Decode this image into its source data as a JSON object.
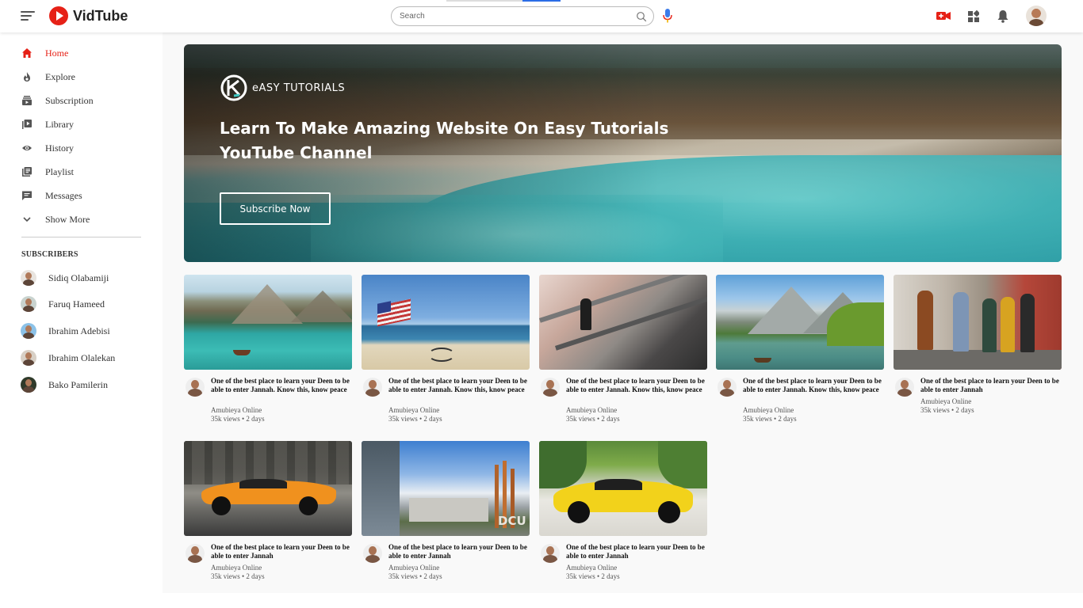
{
  "app": {
    "name": "VidTube"
  },
  "search": {
    "placeholder": "Search"
  },
  "icons": {
    "menu": "menu-icon",
    "logo": "play-logo-icon",
    "search": "search-icon",
    "mic": "mic-icon",
    "upload": "video-upload-icon",
    "apps": "apps-grid-icon",
    "notifications": "bell-icon"
  },
  "colors": {
    "accent": "#e62117",
    "mic_blue": "#3b7bea",
    "search_indicator": "#2b6de6"
  },
  "sidebar": {
    "nav": [
      {
        "label": "Home",
        "icon": "home-icon",
        "active": true
      },
      {
        "label": "Explore",
        "icon": "flame-icon",
        "active": false
      },
      {
        "label": "Subscription",
        "icon": "subscription-icon",
        "active": false
      },
      {
        "label": "Library",
        "icon": "library-icon",
        "active": false
      },
      {
        "label": "History",
        "icon": "eye-icon",
        "active": false
      },
      {
        "label": "Playlist",
        "icon": "playlist-icon",
        "active": false
      },
      {
        "label": "Messages",
        "icon": "message-icon",
        "active": false
      },
      {
        "label": "Show More",
        "icon": "chevron-down-icon",
        "active": false
      }
    ],
    "subscribers_title": "SUBSCRIBERS",
    "subscribers": [
      {
        "name": "Sidiq Olabamiji"
      },
      {
        "name": "Faruq Hameed"
      },
      {
        "name": "Ibrahim Adebisi"
      },
      {
        "name": "Ibrahim Olalekan"
      },
      {
        "name": "Bako Pamilerin"
      }
    ]
  },
  "banner": {
    "logo_text": "eASY TUTORIALS",
    "title": "Learn To Make Amazing Website On Easy Tutorials YouTube Channel",
    "button": "Subscribe Now"
  },
  "videos": [
    {
      "title": "One of the best place to learn your Deen to be able to enter Jannah. Know this, know peace",
      "channel": "Amubieya Online",
      "meta": "35k views • 2 days",
      "thumb": "lake-boat"
    },
    {
      "title": "One of the best place to learn your Deen to be able to enter Jannah. Know this, know peace",
      "channel": "Amubieya Online",
      "meta": "35k views • 2 days",
      "thumb": "beach-flag"
    },
    {
      "title": "One of the best place to learn your Deen to be able to enter Jannah. Know this, know peace",
      "channel": "Amubieya Online",
      "meta": "35k views • 2 days",
      "thumb": "escalator"
    },
    {
      "title": "One of the best place to learn your Deen to be able to enter Jannah. Know this, know peace",
      "channel": "Amubieya Online",
      "meta": "35k views • 2 days",
      "thumb": "mountain-lake"
    },
    {
      "title": "One of the best place to learn your Deen to be able to enter Jannah",
      "channel": "Amubieya Online",
      "meta": "35k views • 2 days",
      "thumb": "friends-walking"
    },
    {
      "title": "One of the best place to learn your Deen to be able to enter Jannah",
      "channel": "Amubieya Online",
      "meta": "35k views • 2 days",
      "thumb": "orange-car"
    },
    {
      "title": "One of the best place to learn your Deen to be able to enter Jannah",
      "channel": "Amubieya Online",
      "meta": "35k views • 2 days",
      "thumb": "dcu-building"
    },
    {
      "title": "One of the best place to learn your Deen to be able to enter Jannah",
      "channel": "Amubieya Online",
      "meta": "35k views • 2 days",
      "thumb": "yellow-car"
    }
  ]
}
